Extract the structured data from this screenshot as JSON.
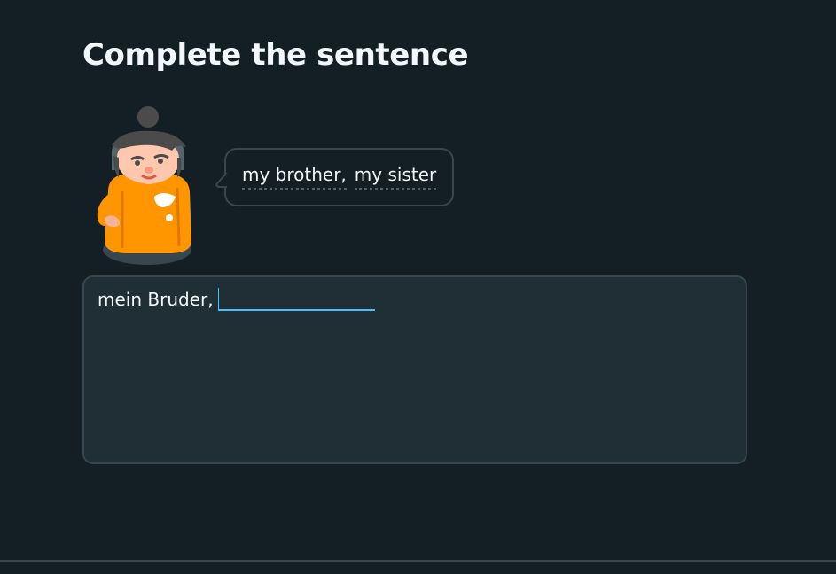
{
  "header": {
    "title": "Complete the sentence"
  },
  "character": {
    "icon": "lesson-character-avatar"
  },
  "prompt": {
    "hints": [
      {
        "text": "my brother,"
      },
      {
        "text": "my sister"
      }
    ]
  },
  "answer": {
    "prefix": "mein Bruder,",
    "value": ""
  },
  "colors": {
    "background": "#131f24",
    "panel": "#202f36",
    "border": "#37464f",
    "focus_accent": "#49c0f8",
    "text": "#f1f7fb"
  }
}
